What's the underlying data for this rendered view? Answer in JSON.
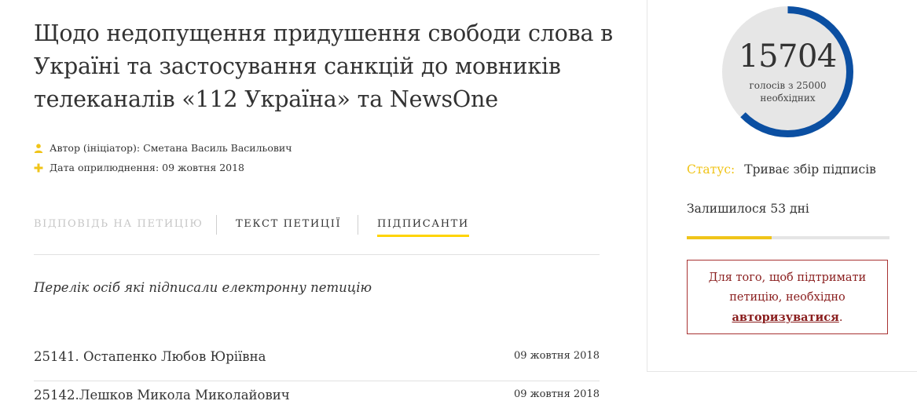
{
  "petition": {
    "title": "Щодо недопущення придушення свободи слова в Україні та застосування санкцій до мовників телеканалів «112 Україна» та NewsOne",
    "author_label": "Автор (ініціатор):",
    "author_name": "Сметана Василь Васильович",
    "date_label": "Дата оприлюднення:",
    "date_value": "09 жовтня 2018"
  },
  "tabs": {
    "answer": "ВІДПОВІДЬ НА ПЕТИЦІЮ",
    "text": "ТЕКСТ ПЕТИЦІЇ",
    "signers": "ПІДПИСАНТИ",
    "active": "signers"
  },
  "signers": {
    "caption": "Перелік осіб які підписали електронну петицію",
    "rows": [
      {
        "name": "25141. Остапенко Любов Юріївна",
        "date": "09 жовтня 2018"
      },
      {
        "name": "25142.Лешков Микола Миколайович",
        "date": "09 жовтня 2018"
      }
    ]
  },
  "sidebar": {
    "count": "15704",
    "count_sub_line1": "голосів з 25000",
    "count_sub_line2": "необхідних",
    "progress_fraction": 0.628,
    "status_label": "Статус:",
    "status_value": "Триває збір підписів",
    "remaining": "Залишилося 53 дні",
    "time_progress_fraction": 0.42,
    "auth_text_before": "Для того, щоб підтримати петицію, необхідно",
    "auth_link": "авторизуватися",
    "auth_text_after": "."
  },
  "colors": {
    "accent_yellow": "#f0c419",
    "gauge_blue": "#0b4fa2",
    "gauge_bg": "#e6e6e6",
    "alert_red": "#8a1e1e"
  },
  "icons": {
    "author": "user-icon",
    "date": "plus-icon"
  }
}
